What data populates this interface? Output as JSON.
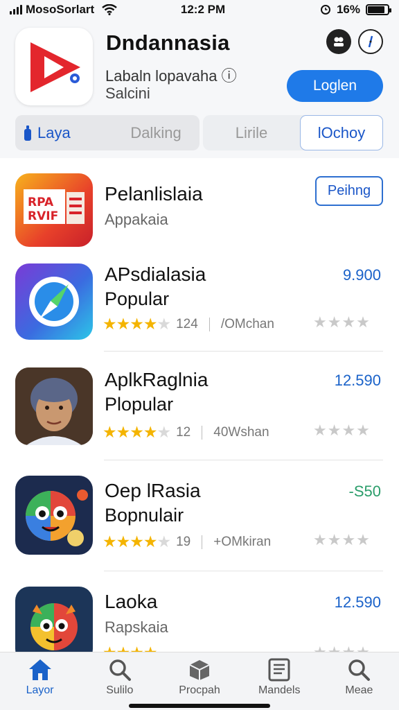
{
  "status_bar": {
    "carrier": "MosoSorlart",
    "time": "12:2 PM",
    "battery_percent": "16%",
    "battery_level": 0.85
  },
  "header": {
    "app_name": "Dndannasia",
    "subtitle_1": "Labaln lopavaha ⓘ",
    "subtitle_2": "Salcini",
    "login_label": "Loglen",
    "icon_1": "profile-icon",
    "icon_2": "compass-icon"
  },
  "segments": {
    "layar": "Laya",
    "dalking": "Dalking",
    "lirile": "Lirile",
    "lochoy": "lOchoy"
  },
  "apps": [
    {
      "title": "Pelanlislaia",
      "subtitle": "Appakaia",
      "action": "Peihng",
      "icon": "film-news-icon"
    },
    {
      "title": "APsdialasia",
      "subtitle": "Popular",
      "rating": 4,
      "count": "124",
      "size": "/OMchan",
      "price": "9.900",
      "icon": "compass-icon"
    },
    {
      "title": "AplkRaglnia",
      "subtitle": "Plopular",
      "rating": 4,
      "count": "12",
      "size": "40Wshan",
      "price": "12.590",
      "icon": "portrait-icon"
    },
    {
      "title": "Oep lRasia",
      "subtitle": "Bopnulair",
      "rating": 4,
      "count": "19",
      "size": "+OMkiran",
      "price": "-S50",
      "icon": "cartoon-monster-icon"
    },
    {
      "title": "Laoka",
      "subtitle": "Rapskaia",
      "rating": 4,
      "price": "12.590",
      "icon": "cartoon-creature-icon"
    }
  ],
  "tab_bar": {
    "tabs": [
      {
        "label": "Layor",
        "icon": "home-icon"
      },
      {
        "label": "Sulilo",
        "icon": "search-icon"
      },
      {
        "label": "Procpah",
        "icon": "box-icon"
      },
      {
        "label": "Mandels",
        "icon": "news-icon"
      },
      {
        "label": "Meae",
        "icon": "search-icon"
      }
    ]
  },
  "colors": {
    "accent": "#1f7ae8",
    "star": "#f4b400",
    "price_blue": "#1a62c9",
    "price_green": "#2a9d6a"
  }
}
